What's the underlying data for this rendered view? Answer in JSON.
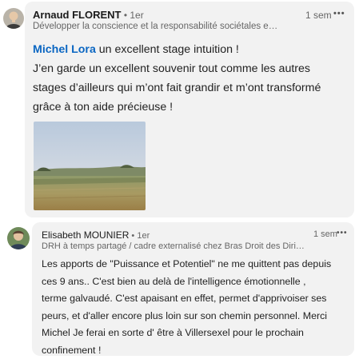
{
  "comments": [
    {
      "author": "Arnaud FLORENT",
      "degree": " • 1er",
      "headline": "Développer la conscience et la responsabilité sociétales e…",
      "time": "1 sem",
      "more_icon": "•••",
      "mention": "Michel Lora",
      "line1_rest": " un excellent stage intuition !",
      "line2": "J’en garde un excellent souvenir tout comme les autres",
      "line3": "stages d’ailleurs qui m’ont fait grandir et m’ont transformé",
      "line4": "grâce à ton aide précieuse !",
      "image_alt": "landscape-photo"
    },
    {
      "author": "Elisabeth MOUNIER",
      "degree": " • 1er",
      "headline": "DRH à temps partagé / cadre externalisé chez Bras Droit des Dirig…",
      "time": "1 sem",
      "more_icon": "•••",
      "lines": [
        "Les apports de \"Puissance et Potentiel\" ne me quittent pas depuis",
        "ces 9 ans.. C'est bien au delà de l'intelligence émotionnelle ,",
        "terme galvaudé. C'est apaisant en effet, permet d'apprivoiser ses",
        "peurs, et d'aller encore plus loin sur son chemin personnel. Merci",
        "Michel Je ferai en sorte d' être à Villersexel pour le prochain",
        "confinement !"
      ]
    }
  ],
  "colors": {
    "bubble": "#f2f2f2",
    "mention": "#0a66c2",
    "secondary_text": "#666666"
  }
}
